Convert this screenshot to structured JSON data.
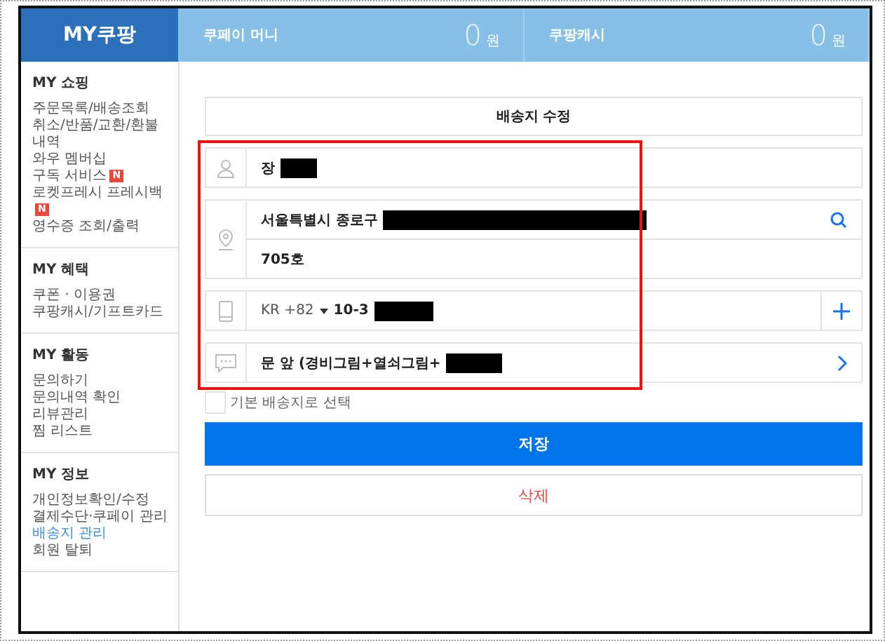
{
  "header": {
    "logo": "MY쿠팡",
    "balances": [
      {
        "label": "쿠페이 머니",
        "amount": "0",
        "unit": "원"
      },
      {
        "label": "쿠팡캐시",
        "amount": "0",
        "unit": "원"
      }
    ]
  },
  "sidebar": {
    "sections": [
      {
        "title": "MY 쇼핑",
        "items": [
          {
            "label": "주문목록/배송조회",
            "selected": false
          },
          {
            "label": "취소/반품/교환/환불 내역",
            "selected": false
          },
          {
            "label": "와우 멤버십",
            "selected": false
          },
          {
            "label": "구독 서비스",
            "selected": false,
            "badge": "N"
          },
          {
            "label": "로켓프레시 프레시백",
            "selected": false,
            "badge": "N"
          },
          {
            "label": "영수증 조회/출력",
            "selected": false
          }
        ]
      },
      {
        "title": "MY 혜택",
        "items": [
          {
            "label": "쿠폰 · 이용권",
            "selected": false
          },
          {
            "label": "쿠팡캐시/기프트카드",
            "selected": false
          }
        ]
      },
      {
        "title": "MY 활동",
        "items": [
          {
            "label": "문의하기",
            "selected": false
          },
          {
            "label": "문의내역 확인",
            "selected": false
          },
          {
            "label": "리뷰관리",
            "selected": false
          },
          {
            "label": "찜 리스트",
            "selected": false
          }
        ]
      },
      {
        "title": "MY 정보",
        "items": [
          {
            "label": "개인정보확인/수정",
            "selected": false
          },
          {
            "label": "결제수단·쿠페이 관리",
            "selected": false
          },
          {
            "label": "배송지 관리",
            "selected": true
          },
          {
            "label": "회원 탈퇴",
            "selected": false
          }
        ]
      }
    ]
  },
  "form": {
    "title": "배송지 수정",
    "highlighted": true,
    "fields": [
      {
        "kind": "name",
        "value": "장",
        "redacted": true
      },
      {
        "kind": "address",
        "value": "서울특별시 종로구",
        "redacted": true,
        "detail": "705호"
      },
      {
        "kind": "phone",
        "country": "KR",
        "code": "+82",
        "value": "10-3",
        "redacted": true
      },
      {
        "kind": "memo",
        "value": "문 앞 (경비그림+열쇠그림+",
        "redacted": true
      }
    ],
    "default_checkbox": {
      "label": "기본 배송지로 선택",
      "checked": false
    },
    "save_button": "저장",
    "delete_button": "삭제"
  }
}
